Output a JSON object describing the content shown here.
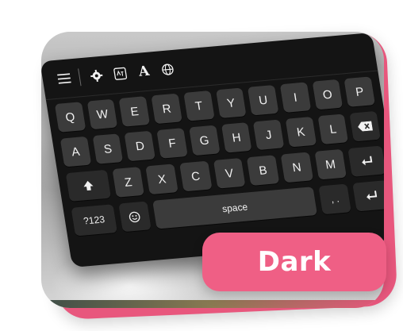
{
  "toolbar": {
    "icons": [
      "menu-icon",
      "gear-icon",
      "translate-icon",
      "font-icon",
      "globe-icon"
    ],
    "font_glyph": "A"
  },
  "keyboard": {
    "row1": [
      "Q",
      "W",
      "E",
      "R",
      "T",
      "Y",
      "U",
      "I",
      "O",
      "P"
    ],
    "row2": [
      "A",
      "S",
      "D",
      "F",
      "G",
      "H",
      "J",
      "K",
      "L"
    ],
    "row3": [
      "Z",
      "X",
      "C",
      "V",
      "B",
      "N",
      "M"
    ],
    "symbols_label": "?123",
    "space_label": "space",
    "punct_label": ", ."
  },
  "badge": {
    "label": "Dark"
  },
  "colors": {
    "accent_pink": "#ef5f85",
    "keyboard_bg": "#141414",
    "key_bg": "#3b3b3b"
  }
}
